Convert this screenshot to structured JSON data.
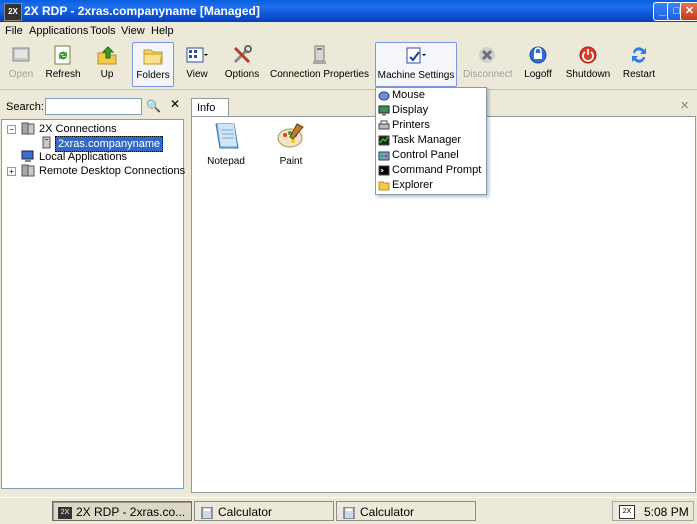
{
  "window": {
    "title": "2X RDP - 2xras.companyname [Managed]",
    "app_icon_text": "2X",
    "buttons": {
      "minimize": "_",
      "maximize": "□",
      "close": "✕"
    }
  },
  "menubar": [
    "File",
    "Applications",
    "Tools",
    "View",
    "Help"
  ],
  "toolbar": [
    {
      "label": "Open",
      "icon": "open-icon",
      "disabled": true
    },
    {
      "label": "Refresh",
      "icon": "refresh-icon",
      "disabled": false
    },
    {
      "label": "Up",
      "icon": "up-icon",
      "disabled": false
    },
    {
      "label": "Folders",
      "icon": "folders-icon",
      "disabled": false,
      "pressed": true
    },
    {
      "label": "View",
      "icon": "view-icon",
      "disabled": false
    },
    {
      "label": "Options",
      "icon": "options-icon",
      "disabled": false
    },
    {
      "label": "Connection Properties",
      "icon": "connection-properties-icon",
      "disabled": false
    },
    {
      "label": "Machine Settings",
      "icon": "machine-settings-icon",
      "disabled": false,
      "pressed": true
    },
    {
      "label": "Disconnect",
      "icon": "disconnect-icon",
      "disabled": true
    },
    {
      "label": "Logoff",
      "icon": "logoff-icon",
      "disabled": false
    },
    {
      "label": "Shutdown",
      "icon": "shutdown-icon",
      "disabled": false
    },
    {
      "label": "Restart",
      "icon": "restart-icon",
      "disabled": false
    }
  ],
  "search": {
    "label": "Search:",
    "value": ""
  },
  "tree": {
    "root_2x": "2X Connections",
    "child_selected": "2xras.companyname",
    "local_apps": "Local Applications",
    "remote_desktop": "Remote Desktop Connections"
  },
  "tab": {
    "label": "Info"
  },
  "apps": [
    {
      "label": "Notepad",
      "icon": "notepad-icon"
    },
    {
      "label": "Paint",
      "icon": "paint-icon"
    }
  ],
  "machine_settings_menu": [
    {
      "label": "Mouse",
      "icon": "mouse-icon"
    },
    {
      "label": "Display",
      "icon": "display-icon"
    },
    {
      "label": "Printers",
      "icon": "printers-icon"
    },
    {
      "label": "Task Manager",
      "icon": "task-manager-icon"
    },
    {
      "label": "Control Panel",
      "icon": "control-panel-icon"
    },
    {
      "label": "Command Prompt",
      "icon": "command-prompt-icon"
    },
    {
      "label": "Explorer",
      "icon": "explorer-icon"
    }
  ],
  "taskbar": {
    "items": [
      {
        "label": "2X RDP - 2xras.co...",
        "active": true
      },
      {
        "label": "Calculator",
        "active": false
      },
      {
        "label": "Calculator",
        "active": false
      }
    ],
    "tray_icon_text": "2X",
    "clock": "5:08 PM"
  },
  "colors": {
    "title_bar": "#0a5fdc",
    "selection": "#316ac5",
    "face": "#ece9d8"
  }
}
